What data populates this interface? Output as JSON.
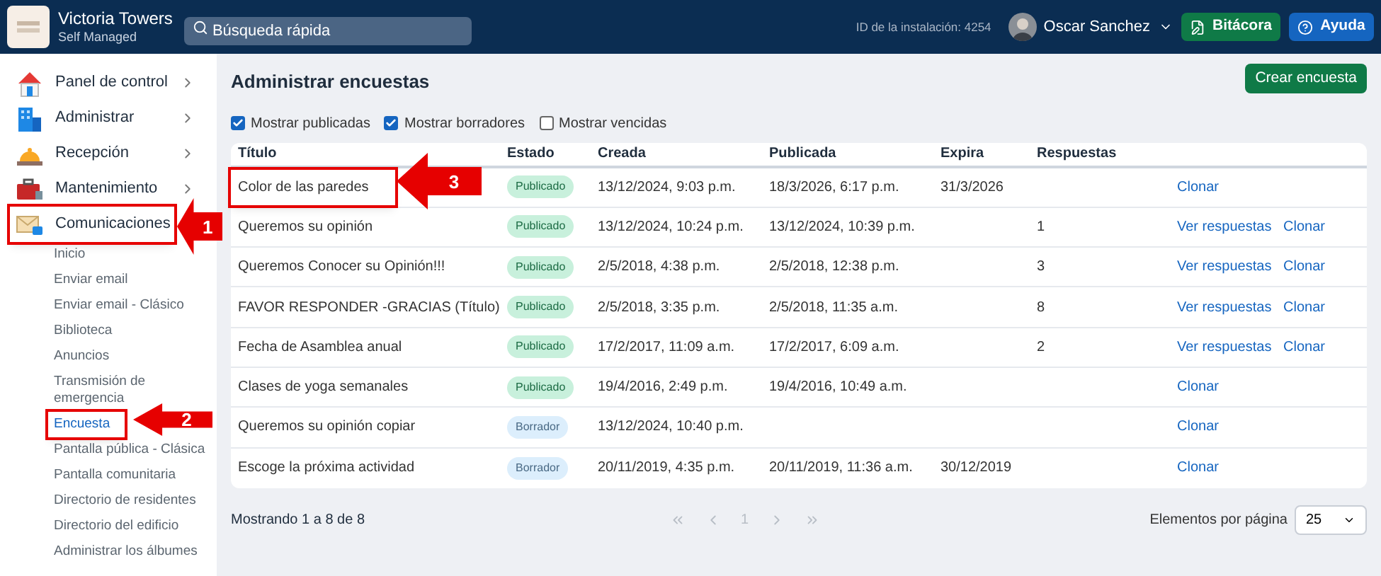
{
  "header": {
    "brand": "Victoria Towers",
    "subtitle": "Self Managed",
    "search": {
      "placeholder": "Búsqueda rápida"
    },
    "install_id": "ID de la instalación: 4254",
    "user": "Oscar Sanchez",
    "buttons": [
      {
        "label": "Bitácora",
        "kind": "log"
      },
      {
        "label": "Ayuda",
        "kind": "help"
      }
    ]
  },
  "sidebar": {
    "items": [
      {
        "label": "Panel de control",
        "kind": "home",
        "selected": false
      },
      {
        "label": "Administrar",
        "kind": "building",
        "selected": false
      },
      {
        "label": "Recepción",
        "kind": "bell",
        "selected": false
      },
      {
        "label": "Mantenimiento",
        "kind": "toolbox",
        "selected": false
      },
      {
        "label": "Comunicaciones",
        "kind": "mail",
        "selected": true,
        "children": [
          {
            "label": "Inicio",
            "selected": false
          },
          {
            "label": "Enviar email",
            "selected": false
          },
          {
            "label": "Enviar email - Clásico",
            "selected": false
          },
          {
            "label": "Biblioteca",
            "selected": false
          },
          {
            "label": "Anuncios",
            "selected": false
          },
          {
            "label": "Transmisión de emergencia",
            "selected": false
          },
          {
            "label": "Encuesta",
            "selected": true
          },
          {
            "label": "Pantalla pública - Clásica",
            "selected": false
          },
          {
            "label": "Pantalla comunitaria",
            "selected": false
          },
          {
            "label": "Directorio de residentes",
            "selected": false
          },
          {
            "label": "Directorio del edificio",
            "selected": false
          },
          {
            "label": "Administrar los álbumes",
            "selected": false
          }
        ]
      }
    ]
  },
  "page": {
    "title": "Administrar encuestas",
    "create_button": "Crear encuesta",
    "filters": [
      {
        "label": "Mostrar publicadas",
        "checked": true
      },
      {
        "label": "Mostrar borradores",
        "checked": true
      },
      {
        "label": "Mostrar vencidas",
        "checked": false
      }
    ],
    "table": {
      "columns": [
        "Título",
        "Estado",
        "Creada",
        "Publicada",
        "Expira",
        "Respuestas"
      ],
      "rows": [
        {
          "title": "Color de las paredes",
          "status": "Publicado",
          "kind": "published",
          "created": "13/12/2024, 9:03 p.m.",
          "published": "18/3/2026, 6:17 p.m.",
          "expires": "31/3/2026",
          "actions": [
            "Clonar"
          ]
        },
        {
          "title": "Queremos su opinión",
          "status": "Publicado",
          "kind": "published",
          "created": "13/12/2024, 10:24 p.m.",
          "published": "13/12/2024, 10:39 p.m.",
          "responses": "1",
          "actions": [
            "Ver respuestas",
            "Clonar"
          ]
        },
        {
          "title": "Queremos Conocer su Opinión!!!",
          "status": "Publicado",
          "kind": "published",
          "created": "2/5/2018, 4:38 p.m.",
          "published": "2/5/2018, 12:38 p.m.",
          "responses": "3",
          "actions": [
            "Ver respuestas",
            "Clonar"
          ]
        },
        {
          "title": "FAVOR RESPONDER -GRACIAS (Título)",
          "status": "Publicado",
          "kind": "published",
          "created": "2/5/2018, 3:35 p.m.",
          "published": "2/5/2018, 11:35 a.m.",
          "responses": "8",
          "actions": [
            "Ver respuestas",
            "Clonar"
          ]
        },
        {
          "title": "Fecha de Asamblea anual",
          "status": "Publicado",
          "kind": "published",
          "created": "17/2/2017, 11:09 a.m.",
          "published": "17/2/2017, 6:09 a.m.",
          "responses": "2",
          "actions": [
            "Ver respuestas",
            "Clonar"
          ]
        },
        {
          "title": "Clases de yoga semanales",
          "status": "Publicado",
          "kind": "published",
          "created": "19/4/2016, 2:49 p.m.",
          "published": "19/4/2016, 10:49 a.m.",
          "actions": [
            "Clonar"
          ]
        },
        {
          "title": "Queremos su opinión copiar",
          "status": "Borrador",
          "kind": "draft",
          "created": "13/12/2024, 10:40 p.m.",
          "actions": [
            "Clonar"
          ]
        },
        {
          "title": "Escoge la próxima actividad",
          "status": "Borrador",
          "kind": "draft",
          "created": "20/11/2019, 4:35 p.m.",
          "published": "20/11/2019, 11:36 a.m.",
          "expires": "30/12/2019",
          "actions": [
            "Clonar"
          ]
        }
      ]
    },
    "footer": {
      "summary": "Mostrando 1 a 8 de 8",
      "page": "1",
      "per_page_label": "Elementos por página",
      "per_page": "25"
    }
  },
  "callouts": [
    {
      "number": "1"
    },
    {
      "number": "2"
    },
    {
      "number": "3"
    }
  ]
}
